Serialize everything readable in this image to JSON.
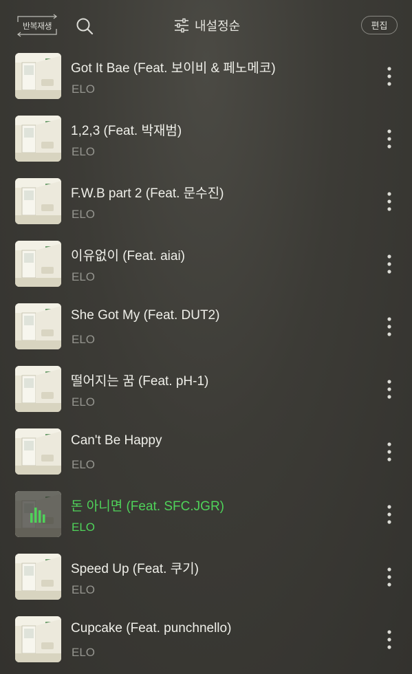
{
  "topbar": {
    "repeat_label": "반복재생",
    "repeat_icon": "repeat-icon",
    "search_icon": "search-icon",
    "sort_icon": "sliders-icon",
    "sort_label": "내설정순",
    "edit_label": "편집"
  },
  "accent_color": "#4fd35a",
  "songs": [
    {
      "title": "Got It Bae (Feat. 보이비 & 페노메코)",
      "artist": "ELO"
    },
    {
      "title": "1,2,3 (Feat. 박재범)",
      "artist": "ELO"
    },
    {
      "title": "F.W.B part 2 (Feat. 문수진)",
      "artist": "ELO"
    },
    {
      "title": "이유없이 (Feat. aiai)",
      "artist": "ELO"
    },
    {
      "title": "She Got My (Feat. DUT2)",
      "artist": "ELO"
    },
    {
      "title": "떨어지는 꿈 (Feat. pH-1)",
      "artist": "ELO"
    },
    {
      "title": "Can't Be Happy",
      "artist": "ELO"
    },
    {
      "title": "돈 아니면 (Feat. SFC.JGR)",
      "artist": "ELO",
      "playing": true
    },
    {
      "title": "Speed Up (Feat. 쿠기)",
      "artist": "ELO"
    },
    {
      "title": "Cupcake (Feat. punchnello)",
      "artist": "ELO"
    }
  ]
}
